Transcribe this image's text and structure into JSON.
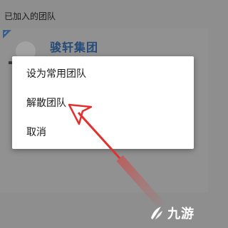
{
  "page": {
    "section_title": "已加入的团队",
    "team_name": "骏轩集团"
  },
  "dialog": {
    "items": [
      {
        "label": "设为常用团队"
      },
      {
        "label": "解散团队"
      },
      {
        "label": "取消"
      }
    ]
  },
  "watermark": {
    "text": "九游",
    "icon": "jiuyou-logo-icon"
  },
  "colors": {
    "overlay": "#8e8e8e",
    "dialog_bg": "#ffffff",
    "team_name": "#244a78",
    "annotation_arrow": "#e03030"
  }
}
